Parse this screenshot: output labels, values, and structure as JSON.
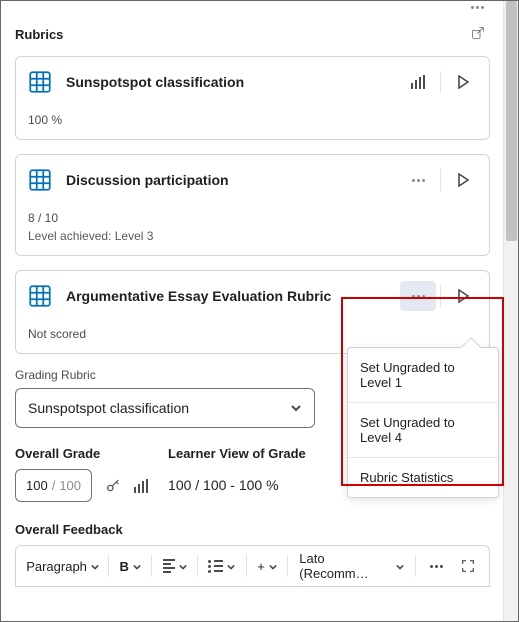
{
  "section": {
    "title": "Rubrics"
  },
  "rubrics": [
    {
      "title": "Sunspotspot classification",
      "score": "100 %",
      "extra": "",
      "actions": {
        "0": "bars",
        "1": "expand"
      }
    },
    {
      "title": "Discussion participation",
      "score": "8 / 10",
      "extra": "Level achieved: Level 3",
      "actions": {
        "0": "more",
        "1": "expand"
      }
    },
    {
      "title": "Argumentative Essay Evaluation Rubric",
      "score": "Not scored",
      "extra": "",
      "actions": {
        "0": "more",
        "1": "expand"
      }
    }
  ],
  "grading_rubric": {
    "label": "Grading Rubric",
    "selected": "Sunspotspot classification"
  },
  "overall_grade": {
    "label": "Overall Grade",
    "earned": "100",
    "slash": "/",
    "total": "100"
  },
  "learner_view": {
    "label": "Learner View of Grade",
    "value": "100 / 100 - 100 %"
  },
  "feedback": {
    "label": "Overall Feedback"
  },
  "toolbar": {
    "para": "Paragraph",
    "bold": "B",
    "plus": "+",
    "font": "Lato (Recomm…"
  },
  "menu": {
    "items": {
      "0": "Set Ungraded to Level 1",
      "1": "Set Ungraded to Level 4",
      "2": "Rubric Statistics"
    }
  }
}
